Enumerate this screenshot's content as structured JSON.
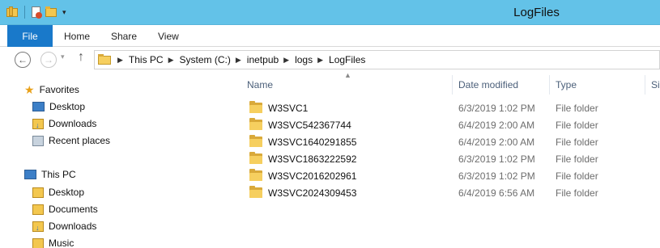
{
  "window": {
    "title": "LogFiles"
  },
  "ribbon": {
    "tabs": [
      "File",
      "Home",
      "Share",
      "View"
    ]
  },
  "address": {
    "crumbs": [
      "This PC",
      "System (C:)",
      "inetpub",
      "logs",
      "LogFiles"
    ]
  },
  "navpane": {
    "favorites_label": "Favorites",
    "favorites": [
      "Desktop",
      "Downloads",
      "Recent places"
    ],
    "thispc_label": "This PC",
    "thispc": [
      "Desktop",
      "Documents",
      "Downloads",
      "Music"
    ]
  },
  "columns": {
    "name": "Name",
    "date": "Date modified",
    "type": "Type",
    "size": "Si"
  },
  "files": [
    {
      "name": "W3SVC1",
      "date": "6/3/2019 1:02 PM",
      "type": "File folder"
    },
    {
      "name": "W3SVC542367744",
      "date": "6/4/2019 2:00 AM",
      "type": "File folder"
    },
    {
      "name": "W3SVC1640291855",
      "date": "6/4/2019 2:00 AM",
      "type": "File folder"
    },
    {
      "name": "W3SVC1863222592",
      "date": "6/3/2019 1:02 PM",
      "type": "File folder"
    },
    {
      "name": "W3SVC2016202961",
      "date": "6/3/2019 1:02 PM",
      "type": "File folder"
    },
    {
      "name": "W3SVC2024309453",
      "date": "6/4/2019 6:56 AM",
      "type": "File folder"
    }
  ],
  "icons": {
    "titlebar": [
      "folder-icon",
      "properties-icon",
      "new-folder-icon",
      "customize-qat-icon"
    ],
    "nav": [
      "back-arrow-icon",
      "forward-arrow-icon",
      "recent-locations-icon",
      "up-arrow-icon"
    ]
  },
  "colors": {
    "titlebar": "#63c2e8",
    "file_tab": "#1979ca",
    "folder": "#f6cf5f"
  }
}
